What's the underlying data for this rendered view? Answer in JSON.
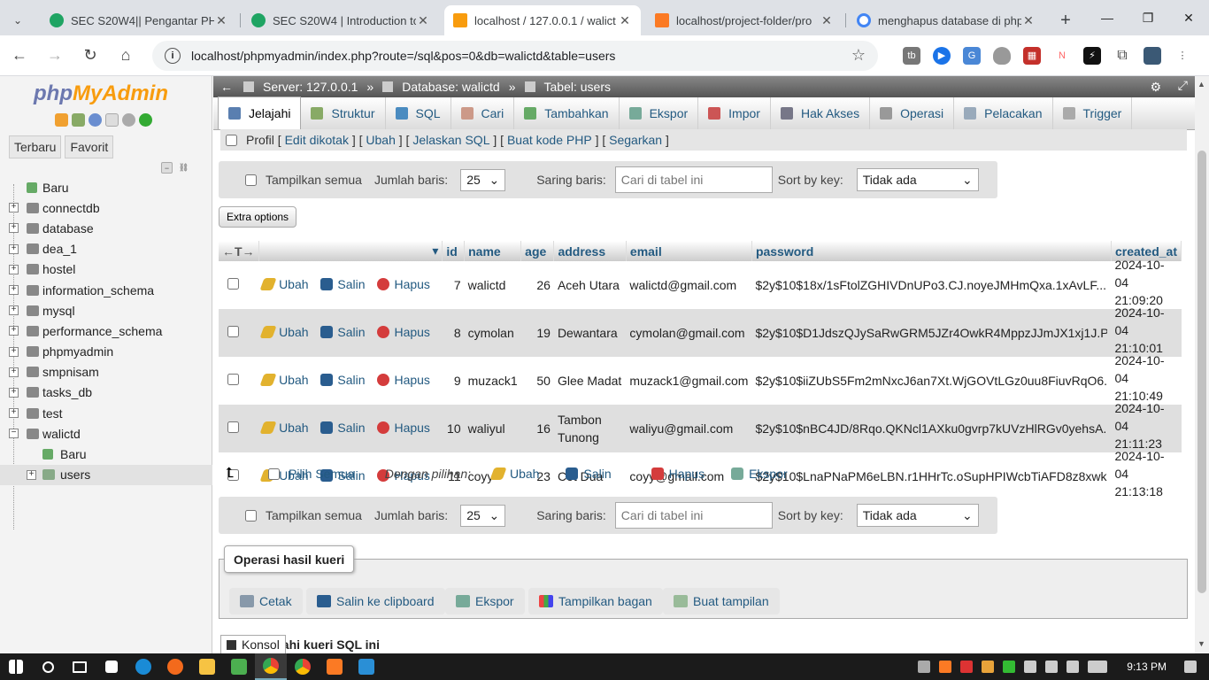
{
  "browser": {
    "tabs": [
      {
        "title": "SEC S20W4|| Pengantar PHP",
        "color": "#1fa463"
      },
      {
        "title": "SEC S20W4 | Introduction to",
        "color": "#1fa463"
      },
      {
        "title": "localhost / 127.0.0.1 / walict",
        "color": "#f89c0e"
      },
      {
        "title": "localhost/project-folder/pro",
        "color": "#fb7a24"
      },
      {
        "title": "menghapus database di php",
        "color": "#4285f4"
      }
    ],
    "url": "localhost/phpmyadmin/index.php?route=/sql&pos=0&db=walictd&table=users"
  },
  "sidebar": {
    "logo_php": "php",
    "logo_admin": "MyAdmin",
    "tab_recent": "Terbaru",
    "tab_fav": "Favorit",
    "items": [
      {
        "label": "Baru"
      },
      {
        "label": "connectdb"
      },
      {
        "label": "database"
      },
      {
        "label": "dea_1"
      },
      {
        "label": "hostel"
      },
      {
        "label": "information_schema"
      },
      {
        "label": "mysql"
      },
      {
        "label": "performance_schema"
      },
      {
        "label": "phpmyadmin"
      },
      {
        "label": "smpnisam"
      },
      {
        "label": "tasks_db"
      },
      {
        "label": "test"
      },
      {
        "label": "walictd"
      },
      {
        "label": "Baru"
      },
      {
        "label": "users"
      }
    ]
  },
  "topbar": {
    "server": "Server: 127.0.0.1",
    "database": "Database: walictd",
    "table": "Tabel: users"
  },
  "menu": {
    "tabs": [
      "Jelajahi",
      "Struktur",
      "SQL",
      "Cari",
      "Tambahkan",
      "Ekspor",
      "Impor",
      "Hak Akses",
      "Operasi",
      "Pelacakan",
      "Trigger"
    ]
  },
  "profile": {
    "label": "Profil",
    "links": [
      "Edit dikotak",
      "Ubah",
      "Jelaskan SQL",
      "Buat kode PHP",
      "Segarkan"
    ]
  },
  "nav": {
    "show_all": "Tampilkan semua",
    "rows_label": "Jumlah baris:",
    "rows_value": "25",
    "filter_label": "Saring baris:",
    "filter_placeholder": "Cari di tabel ini",
    "sort_label": "Sort by key:",
    "sort_value": "Tidak ada"
  },
  "extra_options": "Extra options",
  "table": {
    "columns": [
      "id",
      "name",
      "age",
      "address",
      "email",
      "password",
      "created_at"
    ],
    "action_edit": "Ubah",
    "action_copy": "Salin",
    "action_delete": "Hapus",
    "rows": [
      {
        "id": "7",
        "name": "walictd",
        "age": "26",
        "address": "Aceh Utara",
        "email": "walictd@gmail.com",
        "password": "$2y$10$18x/1sFtolZGHIVDnUPo3.CJ.noyeJMHmQxa.1xAvLF...",
        "created_date": "2024-10-04",
        "created_time": "21:09:20"
      },
      {
        "id": "8",
        "name": "cymolan",
        "age": "19",
        "address": "Dewantara",
        "email": "cymolan@gmail.com",
        "password": "$2y$10$D1JdszQJySaRwGRM5JZr4OwkR4MppzJJmJX1xj1J.PS...",
        "created_date": "2024-10-04",
        "created_time": "21:10:01"
      },
      {
        "id": "9",
        "name": "muzack1",
        "age": "50",
        "address": "Glee Madat",
        "email": "muzack1@gmail.com",
        "password": "$2y$10$iiZUbS5Fm2mNxcJ6an7Xt.WjGOVtLGz0uu8FiuvRqO6...",
        "created_date": "2024-10-04",
        "created_time": "21:10:49"
      },
      {
        "id": "10",
        "name": "waliyul",
        "age": "16",
        "address_line1": "Tambon",
        "address_line2": "Tunong",
        "email": "waliyu@gmail.com",
        "password": "$2y$10$nBC4JD/8Rqo.QKNcl1AXku0gvrp7kUVzHlRGv0yehsA...",
        "created_date": "2024-10-04",
        "created_time": "21:11:23"
      },
      {
        "id": "11",
        "name": "coyy",
        "age": "23",
        "address": "Cot Dua",
        "email": "coyy@gmail.com",
        "password": "$2y$10$LnaPNaPM6eLBN.r1HHrTc.oSupHPIWcbTiAFD8z8xwk...",
        "created_date": "2024-10-04",
        "created_time": "21:13:18"
      }
    ]
  },
  "bulk": {
    "select_all": "Pilih Semua",
    "with_selected": "Dengan pilihan:",
    "edit": "Ubah",
    "copy": "Salin",
    "delete": "Hapus",
    "export": "Ekspor"
  },
  "query_ops": {
    "legend": "Operasi hasil kueri",
    "print": "Cetak",
    "copy_clipboard": "Salin ke clipboard",
    "export": "Ekspor",
    "chart": "Tampilkan bagan",
    "view": "Buat tampilan"
  },
  "console": "Konsol",
  "bookmark": "kahi kueri SQL ini",
  "clock": "9:13 PM"
}
